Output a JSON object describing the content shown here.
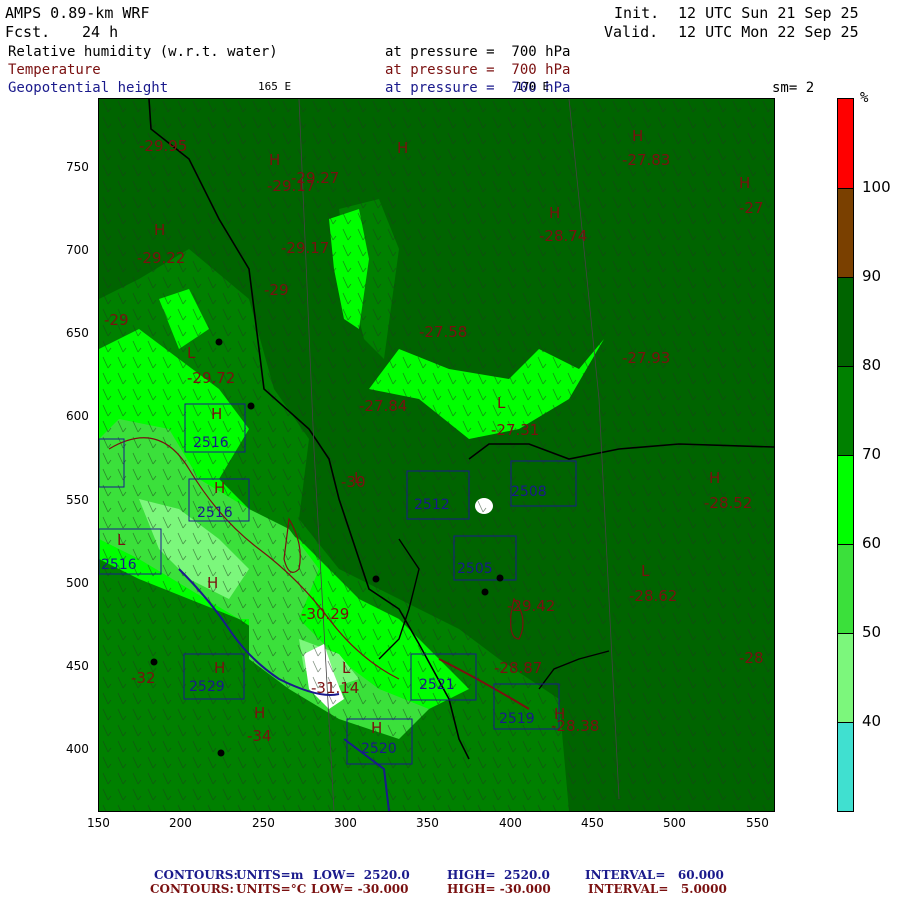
{
  "header": {
    "model": "AMPS 0.89-km WRF",
    "forecast_label": "Fcst.",
    "forecast_hours": "24 h",
    "init_label": "Init.",
    "init_time": "12 UTC Sun 21 Sep 25",
    "valid_label": "Valid.",
    "valid_time": "12 UTC Mon 22 Sep 25"
  },
  "fields": [
    {
      "name": "Relative humidity (w.r.t. water)",
      "level": "at pressure =  700 hPa",
      "color": "#000000"
    },
    {
      "name": "Temperature",
      "level": "at pressure =  700 hPa",
      "color": "#7a1010"
    },
    {
      "name": "Geopotential height",
      "level": "at pressure =  700 hPa",
      "color": "#1a1a8c"
    }
  ],
  "smoothing": "sm= 2",
  "longitude_labels": [
    "165 E",
    "170 E"
  ],
  "axes": {
    "x_ticks": [
      "150",
      "200",
      "250",
      "300",
      "350",
      "400",
      "450",
      "500",
      "550"
    ],
    "y_ticks": [
      "750",
      "700",
      "650",
      "600",
      "550",
      "500",
      "450",
      "400"
    ]
  },
  "colorbar": {
    "unit": "%",
    "levels": [
      "40",
      "50",
      "60",
      "70",
      "80",
      "90",
      "100"
    ],
    "colors": [
      "#40e0d0",
      "#7cf77c",
      "#3be03b",
      "#00ff00",
      "#008000",
      "#006400",
      "#7a4000",
      "#ff0000"
    ]
  },
  "map_labels": {
    "temperatures": [
      "-29.95",
      "-29.17",
      "-29.27",
      "-27.83",
      "-27",
      "-28.74",
      "-29.17",
      "-29.22",
      "-29",
      "-29",
      "-27.58",
      "-27.93",
      "-29.72",
      "-27.84",
      "-27.31",
      "-30",
      "-28.52",
      "-30.29",
      "-28.62",
      "-28.87",
      "-28",
      "-31.14",
      "-28.38",
      "-32",
      "-34",
      "-29.42"
    ],
    "heights": [
      "2516",
      "2516",
      "2516",
      "2529",
      "2505",
      "2508",
      "2512",
      "2519",
      "2521",
      "2520"
    ],
    "highs": [
      "H",
      "H",
      "H",
      "H",
      "H",
      "H",
      "H",
      "H",
      "H",
      "H",
      "H",
      "H",
      "H",
      "H"
    ],
    "lows": [
      "L",
      "L",
      "L",
      "L",
      "L",
      "L"
    ]
  },
  "footer": {
    "line1": {
      "contours": "CONTOURS:",
      "units": "UNITS=m",
      "low": "LOW=  2520.0",
      "high": "HIGH=  2520.0",
      "interval": "INTERVAL=   60.000",
      "color": "#1a1a8c"
    },
    "line2": {
      "contours": "CONTOURS:",
      "units": "UNITS=°C",
      "low": "LOW= -30.000",
      "high": "HIGH= -30.000",
      "interval": "INTERVAL=   5.0000",
      "color": "#7a1010"
    }
  }
}
